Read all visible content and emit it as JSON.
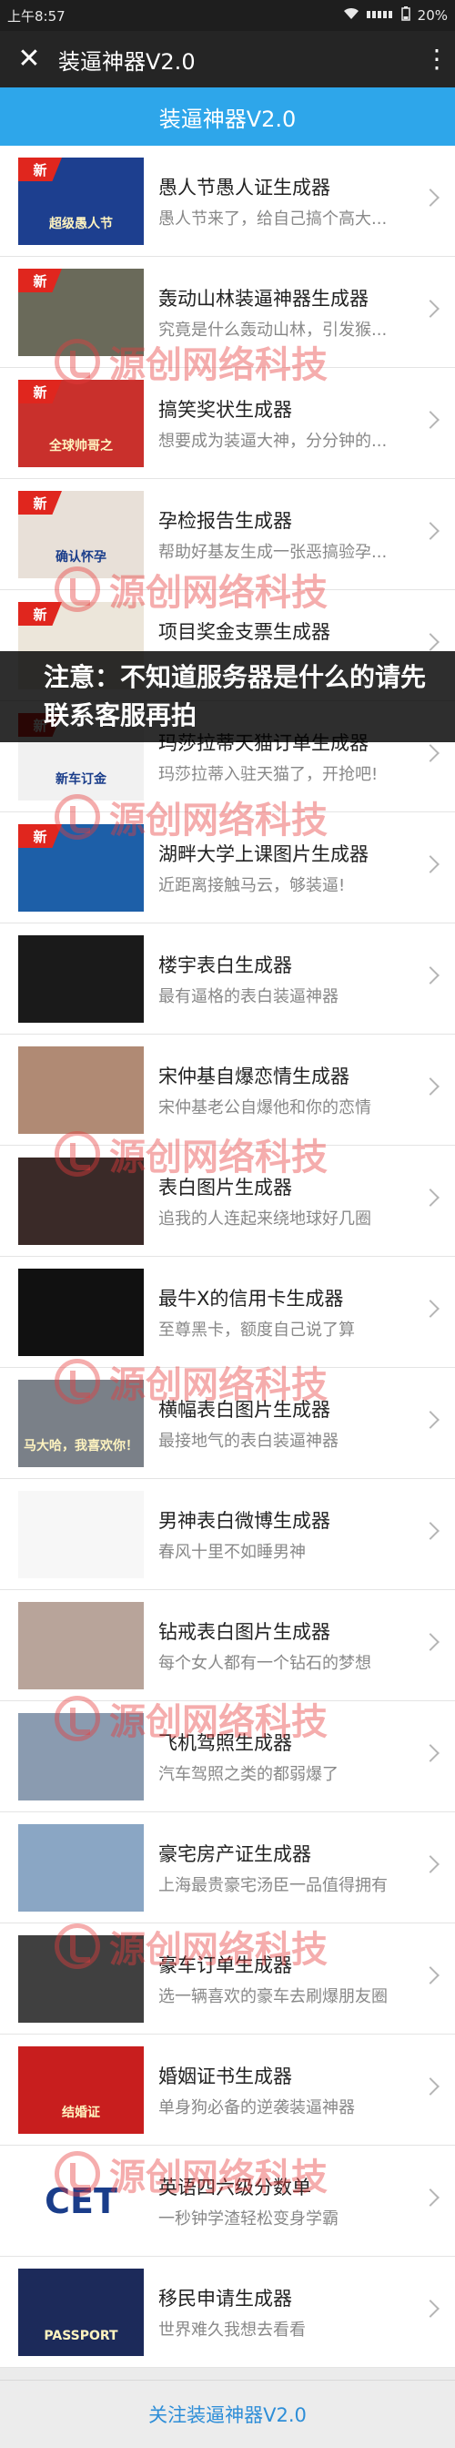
{
  "status_bar": {
    "time": "上午8:57",
    "battery": "20%"
  },
  "title_bar": {
    "title": "装逼神器V2.0"
  },
  "header": {
    "title": "装逼神器V2.0"
  },
  "badge_label": "新",
  "watermark_text": "源创网络科技",
  "notice": "注意：不知道服务器是什么的请先联系客服再拍",
  "items": [
    {
      "title": "愚人节愚人证生成器",
      "desc": "愚人节来了，给自己搞个高大...",
      "new": true,
      "thumb": "愚人节证书封面",
      "thumb_text": "超级愚人节",
      "thumb_color": "#1d3f8f"
    },
    {
      "title": "轰动山林装逼神器生成器",
      "desc": "究竟是什么轰动山林，引发猴...",
      "new": true,
      "thumb": "猴子看报纸",
      "thumb_text": "",
      "thumb_color": "#6a6a5a"
    },
    {
      "title": "搞笑奖状生成器",
      "desc": "想要成为装逼大神，分分钟的...",
      "new": true,
      "thumb": "奖状",
      "thumb_text": "全球帅哥之",
      "thumb_color": "#c9302c"
    },
    {
      "title": "孕检报告生成器",
      "desc": "帮助好基友生成一张恶搞验孕...",
      "new": true,
      "thumb": "孕检报告单",
      "thumb_text": "确认怀孕",
      "thumb_color": "#e8e0d8"
    },
    {
      "title": "项目奖金支票生成器",
      "desc": "",
      "new": true,
      "thumb": "支票",
      "thumb_text": "",
      "thumb_color": "#ece6da"
    },
    {
      "title": "玛莎拉蒂天猫订单生成器",
      "desc": "玛莎拉蒂入驻天猫了，开抢吧!",
      "new": true,
      "thumb": "新车订金",
      "thumb_text": "新车订金",
      "thumb_color": "#f1f1f1"
    },
    {
      "title": "湖畔大学上课图片生成器",
      "desc": "近距离接触马云，够装逼!",
      "new": true,
      "thumb": "讲台演讲",
      "thumb_text": "",
      "thumb_color": "#1d5fa8"
    },
    {
      "title": "楼宇表白生成器",
      "desc": "最有逼格的表白装逼神器",
      "new": false,
      "thumb": "楼宇夜景",
      "thumb_text": "",
      "thumb_color": "#1a1a1a"
    },
    {
      "title": "宋仲基自爆恋情生成器",
      "desc": "宋仲基老公自爆他和你的恋情",
      "new": false,
      "thumb": "人物照片",
      "thumb_text": "",
      "thumb_color": "#b08a74"
    },
    {
      "title": "表白图片生成器",
      "desc": "追我的人连起来绕地球好几圈",
      "new": false,
      "thumb": "女生照片",
      "thumb_text": "",
      "thumb_color": "#3a2a28"
    },
    {
      "title": "最牛X的信用卡生成器",
      "desc": "至尊黑卡，额度自己说了算",
      "new": false,
      "thumb": "黑卡",
      "thumb_text": "",
      "thumb_color": "#111111"
    },
    {
      "title": "横幅表白图片生成器",
      "desc": "最接地气的表白装逼神器",
      "new": false,
      "thumb": "红色横幅",
      "thumb_text": "马大哈，我喜欢你！",
      "thumb_color": "#7a8088"
    },
    {
      "title": "男神表白微博生成器",
      "desc": "春风十里不如睡男神",
      "new": false,
      "thumb": "微博截图",
      "thumb_text": "",
      "thumb_color": "#f7f7f7"
    },
    {
      "title": "钻戒表白图片生成器",
      "desc": "每个女人都有一个钻石的梦想",
      "new": false,
      "thumb": "钻戒",
      "thumb_text": "",
      "thumb_color": "#b8a49a"
    },
    {
      "title": "飞机驾照生成器",
      "desc": "汽车驾照之类的都弱爆了",
      "new": false,
      "thumb": "机翼徽章",
      "thumb_text": "",
      "thumb_color": "#8a9bb0"
    },
    {
      "title": "豪宅房产证生成器",
      "desc": "上海最贵豪宅汤臣一品值得拥有",
      "new": false,
      "thumb": "高楼",
      "thumb_text": "",
      "thumb_color": "#8aa6c4"
    },
    {
      "title": "豪车订单生成器",
      "desc": "选一辆喜欢的豪车去刷爆朋友圈",
      "new": false,
      "thumb": "红色跑车",
      "thumb_text": "",
      "thumb_color": "#404040"
    },
    {
      "title": "婚姻证书生成器",
      "desc": "单身狗必备的逆袭装逼神器",
      "new": false,
      "thumb": "结婚证",
      "thumb_text": "结婚证",
      "thumb_color": "#c81e1e"
    },
    {
      "title": "英语四六级分数单",
      "desc": "一秒钟学渣轻松变身学霸",
      "new": false,
      "thumb": "CET标志",
      "thumb_text": "CET",
      "thumb_color": "#ffffff"
    },
    {
      "title": "移民申请生成器",
      "desc": "世界难久我想去看看",
      "new": false,
      "thumb": "护照与国旗",
      "thumb_text": "PASSPORT",
      "thumb_color": "#1c2a5a"
    }
  ],
  "footer": {
    "label": "关注装逼神器V2.0"
  }
}
